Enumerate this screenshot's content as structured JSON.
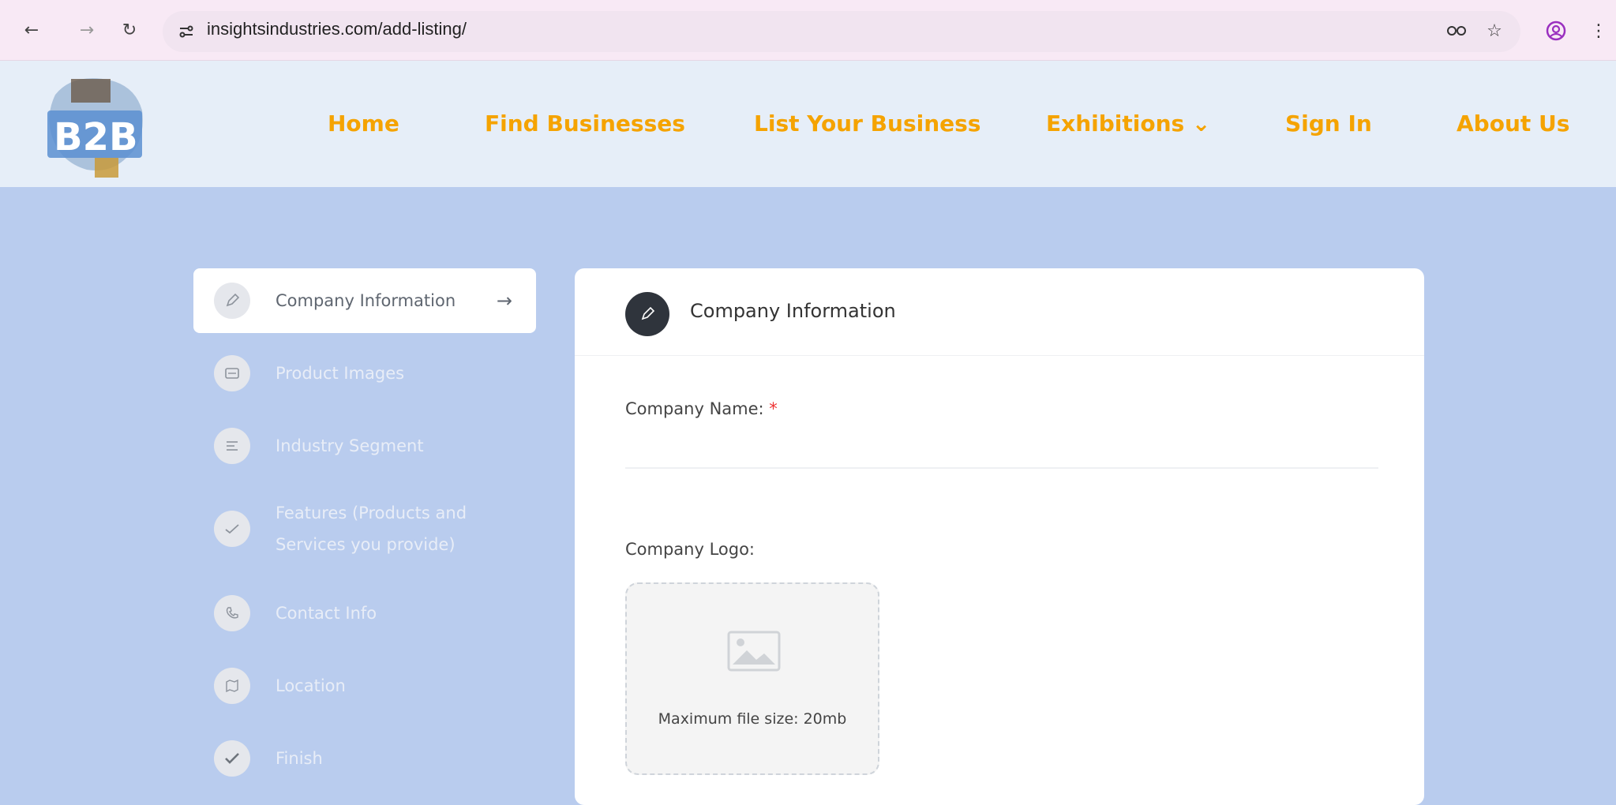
{
  "browser": {
    "url": "insightsindustries.com/add-listing/",
    "back_icon": "arrow-left",
    "forward_icon": "arrow-right",
    "reload_icon": "reload",
    "site_settings_icon": "tune"
  },
  "nav": {
    "items": [
      {
        "label": "Home"
      },
      {
        "label": "Find Businesses"
      },
      {
        "label": "List Your Business"
      },
      {
        "label": "Exhibitions ⌄"
      },
      {
        "label": "Sign In"
      },
      {
        "label": "About Us"
      }
    ],
    "color": "#f5a300"
  },
  "steps": [
    {
      "label": "Company Information",
      "icon": "pen",
      "active": true
    },
    {
      "label": "Product Images",
      "icon": "images"
    },
    {
      "label": "Industry Segment",
      "icon": "list"
    },
    {
      "label": "Features (Products and Services you provide)",
      "icon": "check"
    },
    {
      "label": "Contact Info",
      "icon": "phone"
    },
    {
      "label": "Location",
      "icon": "map"
    },
    {
      "label": "Finish",
      "icon": "check-bold"
    }
  ],
  "card": {
    "title": "Company Information",
    "company_name_label": "Company Name:",
    "required_mark": "*",
    "company_name_value": "",
    "company_logo_label": "Company Logo:",
    "upload_hint": "Maximum file size: 20mb"
  },
  "colors": {
    "page_bg": "#b9ccee",
    "header_bg": "#e6eef8",
    "accent": "#f5a300",
    "card_icon_bg": "#2f343c"
  }
}
